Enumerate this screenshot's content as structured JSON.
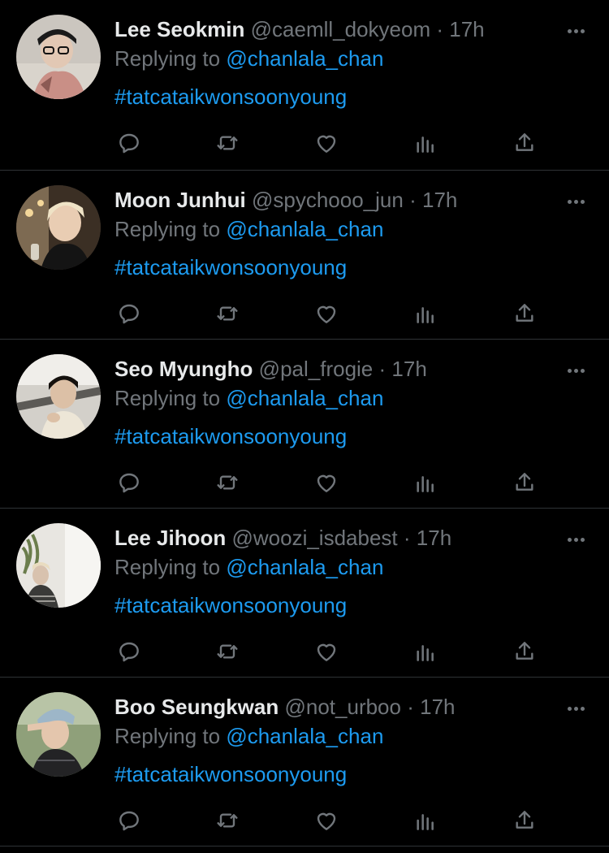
{
  "colors": {
    "background": "#000000",
    "name": "#e7e9ea",
    "muted": "#71767b",
    "link": "#1d9bf0",
    "divider": "#2f3336"
  },
  "icons": {
    "reply": "reply-icon",
    "retweet": "retweet-icon",
    "like": "heart-icon",
    "views": "views-icon",
    "share": "share-icon",
    "more": "more-icon"
  },
  "tweets": [
    {
      "display_name": "Lee Seokmin",
      "handle": "@caemll_dokyeom",
      "separator": "·",
      "time": "17h",
      "replying_prefix": "Replying to",
      "replying_to": "@chanlala_chan",
      "text": "#tatcataikwonsoonyoung"
    },
    {
      "display_name": "Moon Junhui",
      "handle": "@spychooo_jun",
      "separator": "·",
      "time": "17h",
      "replying_prefix": "Replying to",
      "replying_to": "@chanlala_chan",
      "text": "#tatcataikwonsoonyoung"
    },
    {
      "display_name": "Seo Myungho",
      "handle": "@pal_frogie",
      "separator": "·",
      "time": "17h",
      "replying_prefix": "Replying to",
      "replying_to": "@chanlala_chan",
      "text": "#tatcataikwonsoonyoung"
    },
    {
      "display_name": "Lee Jihoon",
      "handle": "@woozi_isdabest",
      "separator": "·",
      "time": "17h",
      "replying_prefix": "Replying to",
      "replying_to": "@chanlala_chan",
      "text": "#tatcataikwonsoonyoung"
    },
    {
      "display_name": "Boo Seungkwan",
      "handle": "@not_urboo",
      "separator": "·",
      "time": "17h",
      "replying_prefix": "Replying to",
      "replying_to": "@chanlala_chan",
      "text": "#tatcataikwonsoonyoung"
    }
  ]
}
